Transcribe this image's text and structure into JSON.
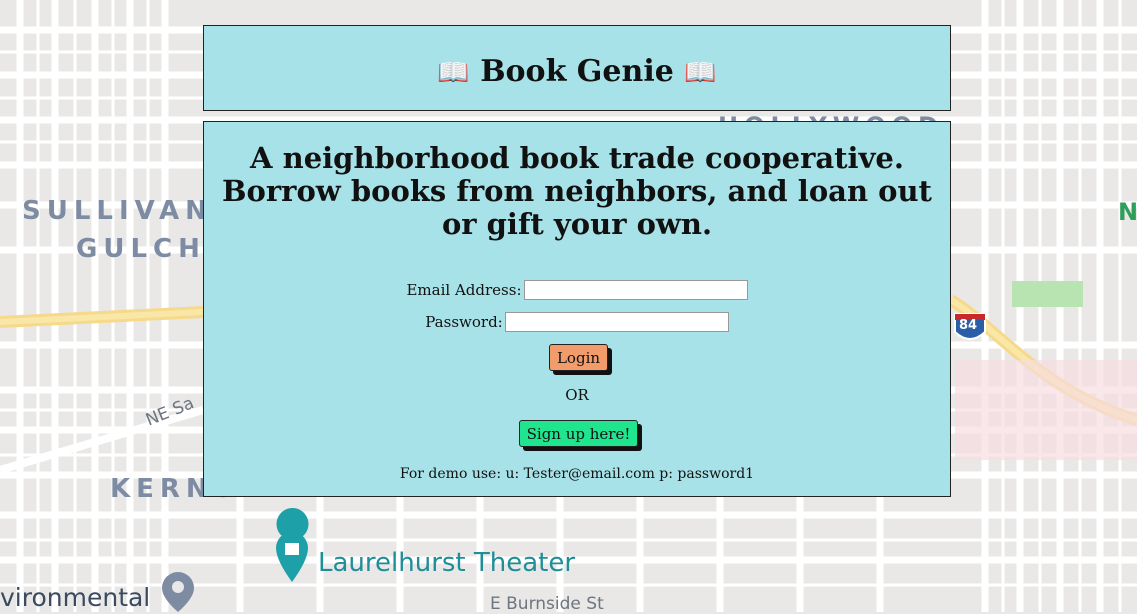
{
  "header": {
    "title": "Book Genie",
    "icon_left": "📖",
    "icon_right": "📖"
  },
  "main": {
    "tagline": "A neighborhood book trade cooperative. Borrow books from neighbors, and loan out or gift your own.",
    "email_label": "Email Address:",
    "email_value": "",
    "password_label": "Password:",
    "password_value": "",
    "login_label": "Login",
    "or_text": "OR",
    "signup_label": "Sign up here!",
    "demo_text": "For demo use: u: Tester@email.com p: password1"
  },
  "map": {
    "labels": {
      "sullivan": "SULLIVAN",
      "gulch": "GULCH",
      "kerns": "KERNS",
      "hollywood": "HOLLYWOOD",
      "theater": "Laurelhurst Theater",
      "environmental": "vironmental",
      "burnside": "E Burnside St",
      "ne_sandy": "NE Sa",
      "highway": "84",
      "n_edge": "N"
    }
  },
  "colors": {
    "panel_bg": "#a7e2e8",
    "login_button": "#f39c6b",
    "signup_button": "#1fe58e"
  }
}
